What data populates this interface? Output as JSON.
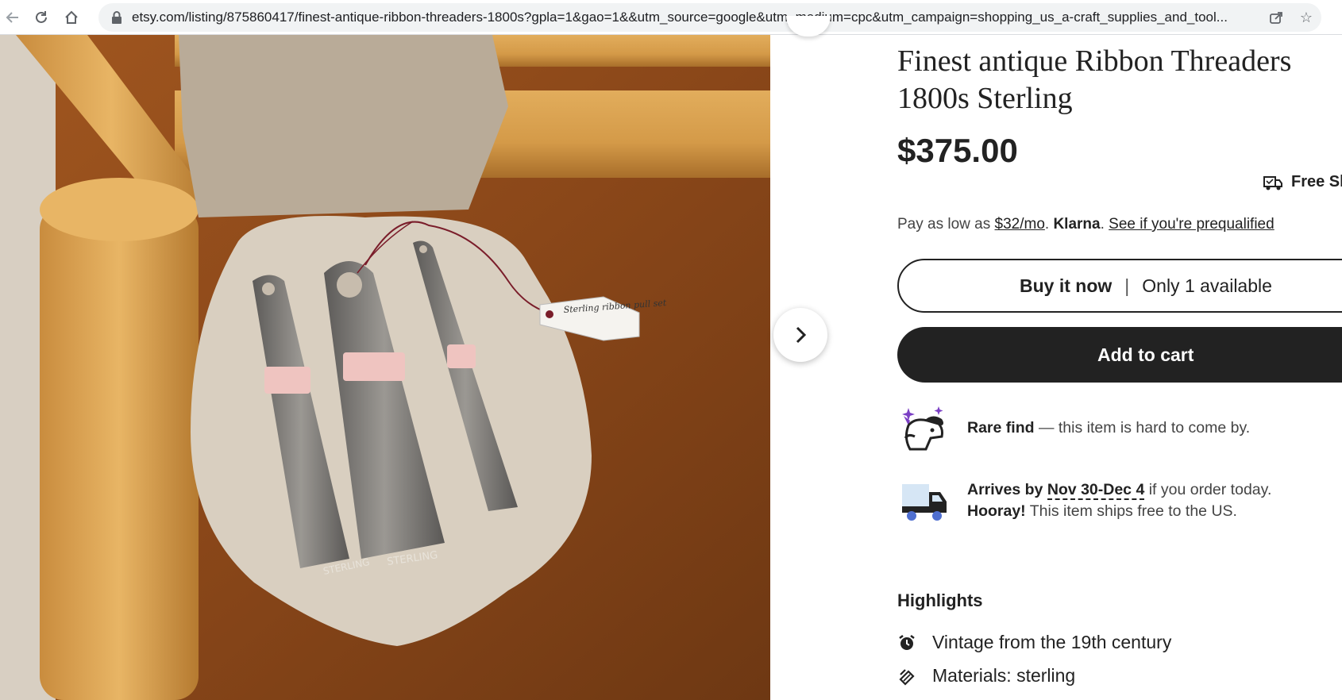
{
  "browser": {
    "url": "etsy.com/listing/875860417/finest-antique-ribbon-threaders-1800s?gpla=1&gao=1&&utm_source=google&utm_medium=cpc&utm_campaign=shopping_us_a-craft_supplies_and_tool..."
  },
  "listing": {
    "title": "Finest antique Ribbon Threaders 1800s Sterling",
    "price": "$375.00",
    "free_shipping": "Free Sh",
    "klarna": {
      "prefix": "Pay as low as",
      "amount": "$32/mo",
      "brand": "Klarna",
      "link": "See if you're prequalified"
    },
    "buy_now_label": "Buy it now",
    "availability": "Only 1 available",
    "add_to_cart_label": "Add to cart",
    "rare_find": {
      "bold": "Rare find",
      "text": "— this item is hard to come by."
    },
    "delivery": {
      "arrives_label": "Arrives by",
      "dates": "Nov 30-Dec 4",
      "suffix": "if you order today.",
      "hooray": "Hooray!",
      "ships_free": "This item ships free to the US."
    },
    "highlights": {
      "title": "Highlights",
      "items": [
        {
          "icon": "clock-icon",
          "text": "Vintage from the 19th century"
        },
        {
          "icon": "materials-icon",
          "text": "Materials: sterling"
        }
      ]
    }
  },
  "photo": {
    "tag_text": "Sterling ribbon pull set",
    "stamp_1": "STERLING",
    "stamp_2": "STERLING"
  },
  "colors": {
    "button_dark": "#222222",
    "truck_blue": "#4f6fd0",
    "truck_body": "#d6e6f5",
    "sparkle": "#7b3fc4"
  }
}
